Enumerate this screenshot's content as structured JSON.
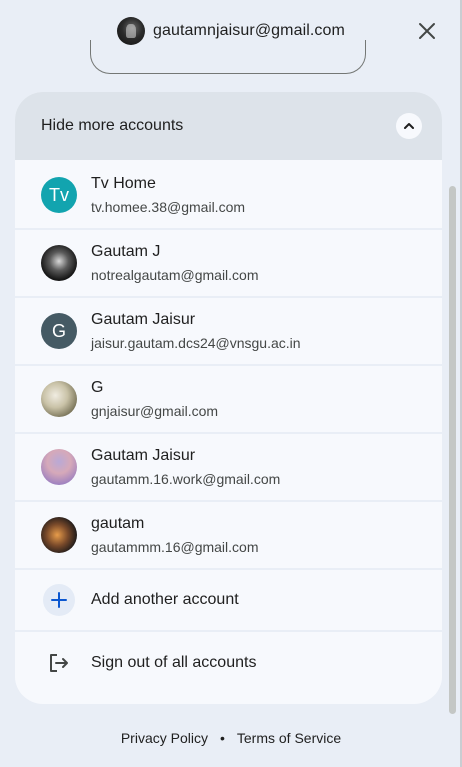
{
  "header": {
    "email": "gautamnjaisur@gmail.com",
    "close_icon": "close-icon"
  },
  "accounts_panel": {
    "toggle_label": "Hide more accounts",
    "toggle_icon": "chevron-up-icon",
    "accounts": [
      {
        "name": "Tv Home",
        "email": "tv.homee.38@gmail.com",
        "avatar_letter": "Tv",
        "avatar_color": "#12a4af"
      },
      {
        "name": "Gautam J",
        "email": "notrealgautam@gmail.com",
        "avatar_letter": "",
        "avatar_type": "photo"
      },
      {
        "name": "Gautam Jaisur",
        "email": "jaisur.gautam.dcs24@vnsgu.ac.in",
        "avatar_letter": "G",
        "avatar_color": "#455a64"
      },
      {
        "name": "G",
        "email": "gnjaisur@gmail.com",
        "avatar_letter": "",
        "avatar_type": "photo"
      },
      {
        "name": "Gautam Jaisur",
        "email": "gautamm.16.work@gmail.com",
        "avatar_letter": "",
        "avatar_type": "photo"
      },
      {
        "name": "gautam",
        "email": "gautammm.16@gmail.com",
        "avatar_letter": "",
        "avatar_type": "photo"
      }
    ],
    "add_account_label": "Add another account",
    "sign_out_label": "Sign out of all accounts"
  },
  "footer": {
    "privacy": "Privacy Policy",
    "separator": "•",
    "terms": "Terms of Service"
  }
}
